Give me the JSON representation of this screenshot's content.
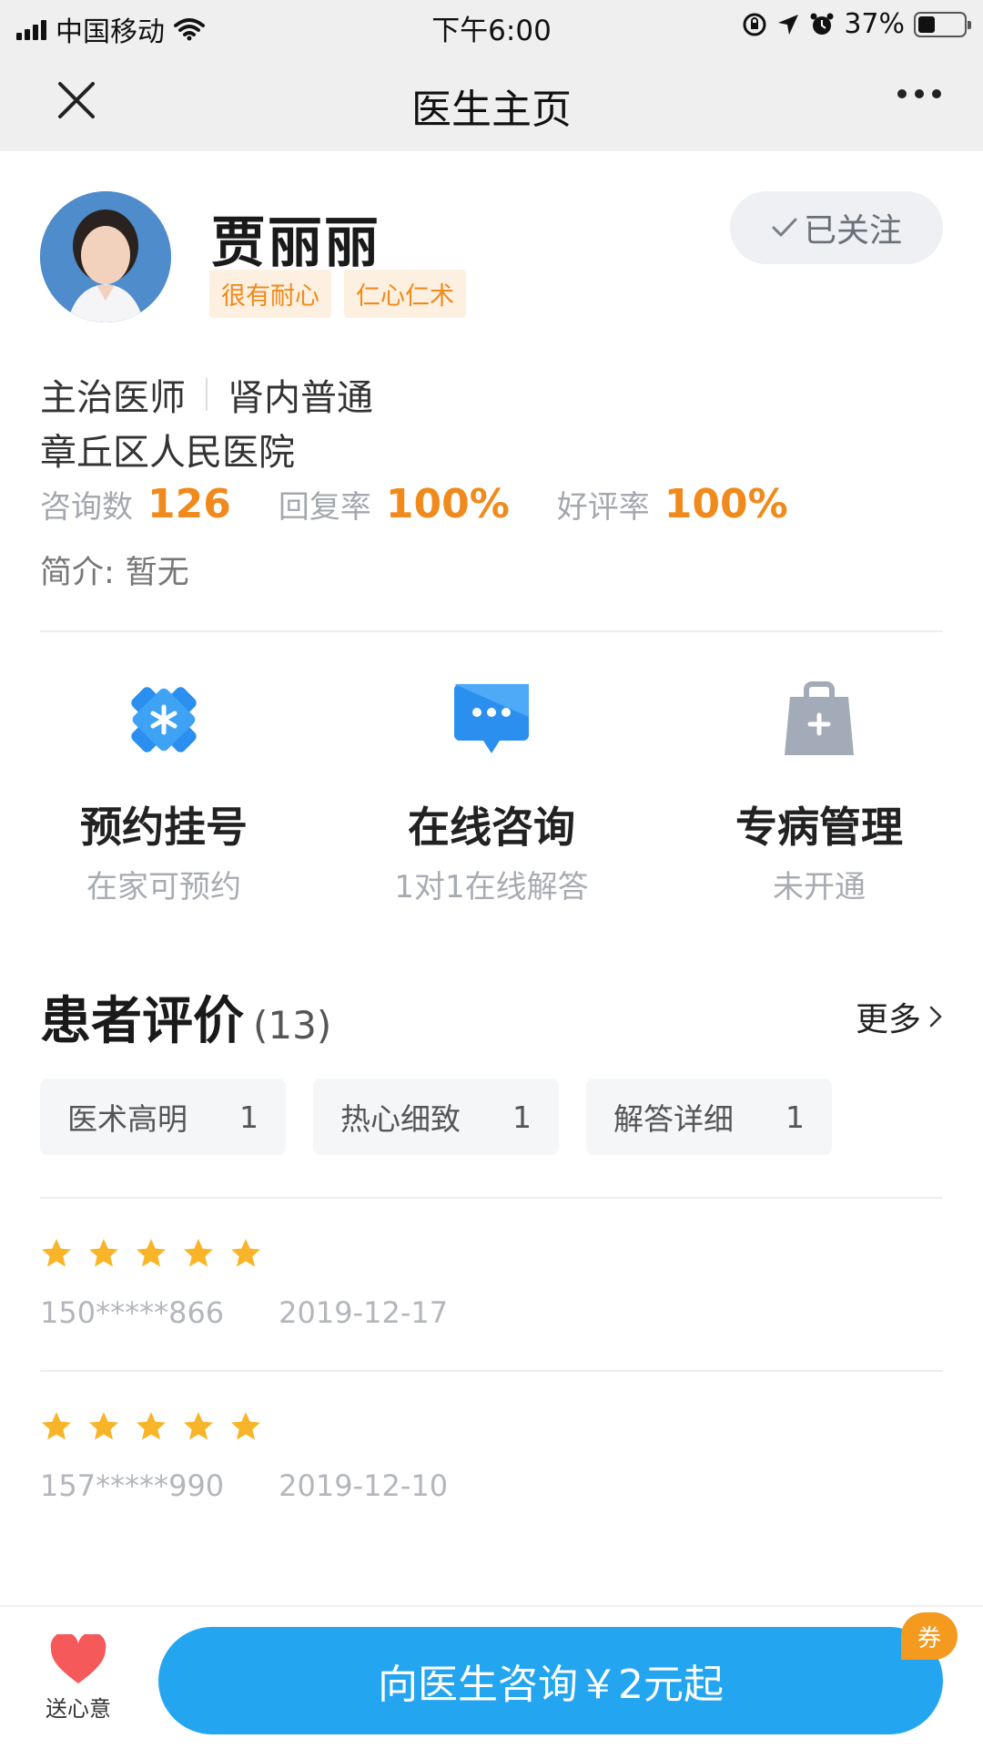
{
  "status_bar": {
    "carrier": "中国移动",
    "time": "下午6:00",
    "battery": "37%",
    "battery_level": 0.37
  },
  "nav": {
    "title": "医生主页"
  },
  "doctor": {
    "name": "贾丽丽",
    "tags": [
      "很有耐心",
      "仁心仁术"
    ],
    "follow_label": "已关注",
    "position": "主治医师",
    "department": "肾内普通",
    "hospital": "章丘区人民医院",
    "stats": [
      {
        "label": "咨询数",
        "value": "126"
      },
      {
        "label": "回复率",
        "value": "100%"
      },
      {
        "label": "好评率",
        "value": "100%"
      }
    ],
    "intro_label": "简介:",
    "intro_value": "暂无"
  },
  "services": [
    {
      "name": "预约挂号",
      "sub": "在家可预约",
      "icon": "hospital-cross-icon",
      "color": "#2a8fee"
    },
    {
      "name": "在线咨询",
      "sub": "1对1在线解答",
      "icon": "chat-bubble-icon",
      "color": "#2a8fee"
    },
    {
      "name": "专病管理",
      "sub": "未开通",
      "icon": "medical-bag-icon",
      "color": "#a3abb8"
    }
  ],
  "reviews": {
    "title": "患者评价",
    "count": "(13)",
    "more": "更多",
    "chips": [
      {
        "label": "医术高明",
        "count": "1"
      },
      {
        "label": "热心细致",
        "count": "1"
      },
      {
        "label": "解答详细",
        "count": "1"
      }
    ],
    "items": [
      {
        "stars": 5,
        "user": "150*****866",
        "date": "2019-12-17"
      },
      {
        "stars": 5,
        "user": "157*****990",
        "date": "2019-12-10"
      }
    ]
  },
  "bottom": {
    "gift_label": "送心意",
    "consult_label": "向医生咨询￥2元起",
    "coupon": "券"
  },
  "colors": {
    "accent": "#24a5ef",
    "orange": "#f08a1c",
    "star": "#f8b52a",
    "heart": "#f5595a"
  }
}
